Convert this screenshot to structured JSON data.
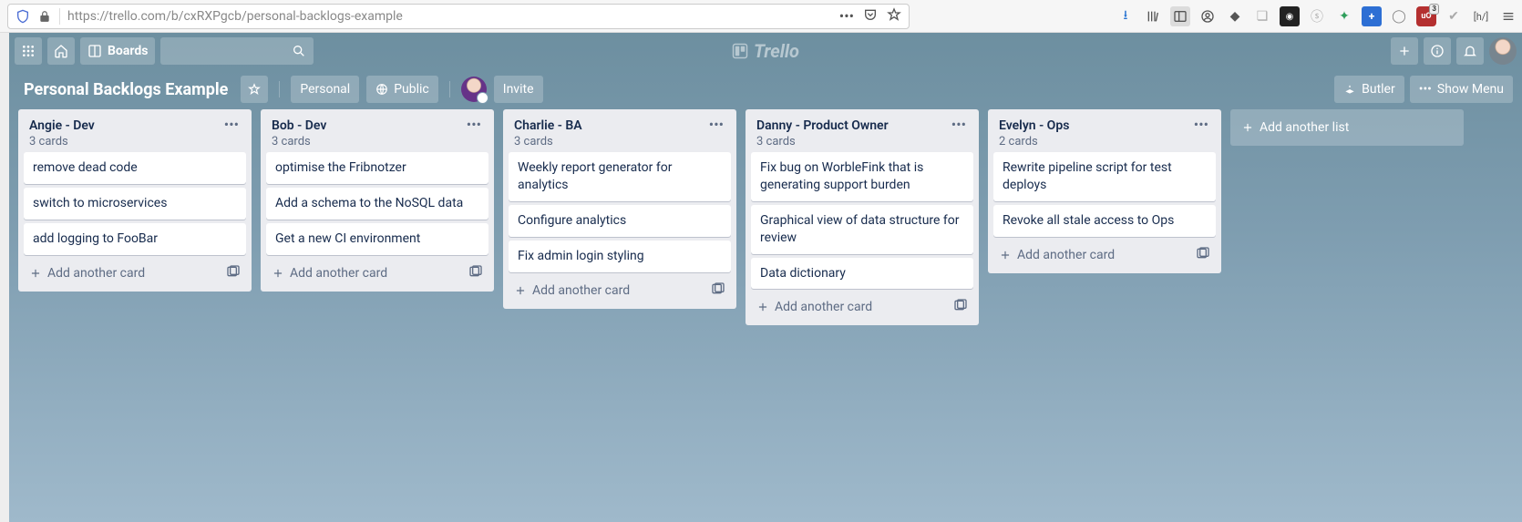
{
  "browser": {
    "url": "https://trello.com/b/cxRXPgcb/personal-backlogs-example"
  },
  "header": {
    "boards_label": "Boards",
    "logo": "Trello"
  },
  "board_header": {
    "name": "Personal Backlogs Example",
    "team": "Personal",
    "visibility": "Public",
    "invite": "Invite",
    "butler": "Butler",
    "show_menu": "Show Menu"
  },
  "lists": [
    {
      "name": "Angie - Dev",
      "count": "3 cards",
      "cards": [
        "remove dead code",
        "switch to microservices",
        "add logging to FooBar"
      ]
    },
    {
      "name": "Bob - Dev",
      "count": "3 cards",
      "cards": [
        "optimise the Fribnotzer",
        "Add a schema to the NoSQL data",
        "Get a new CI environment"
      ]
    },
    {
      "name": "Charlie - BA",
      "count": "3 cards",
      "cards": [
        "Weekly report generator for analytics",
        "Configure analytics",
        "Fix admin login styling"
      ]
    },
    {
      "name": "Danny - Product Owner",
      "count": "3 cards",
      "cards": [
        "Fix bug on WorbleFink that is generating support burden",
        "Graphical view of data structure for review",
        "Data dictionary"
      ]
    },
    {
      "name": "Evelyn - Ops",
      "count": "2 cards",
      "cards": [
        "Rewrite pipeline script for test deploys",
        "Revoke all stale access to Ops"
      ]
    }
  ],
  "add_card": "Add another card",
  "add_list": "Add another list"
}
